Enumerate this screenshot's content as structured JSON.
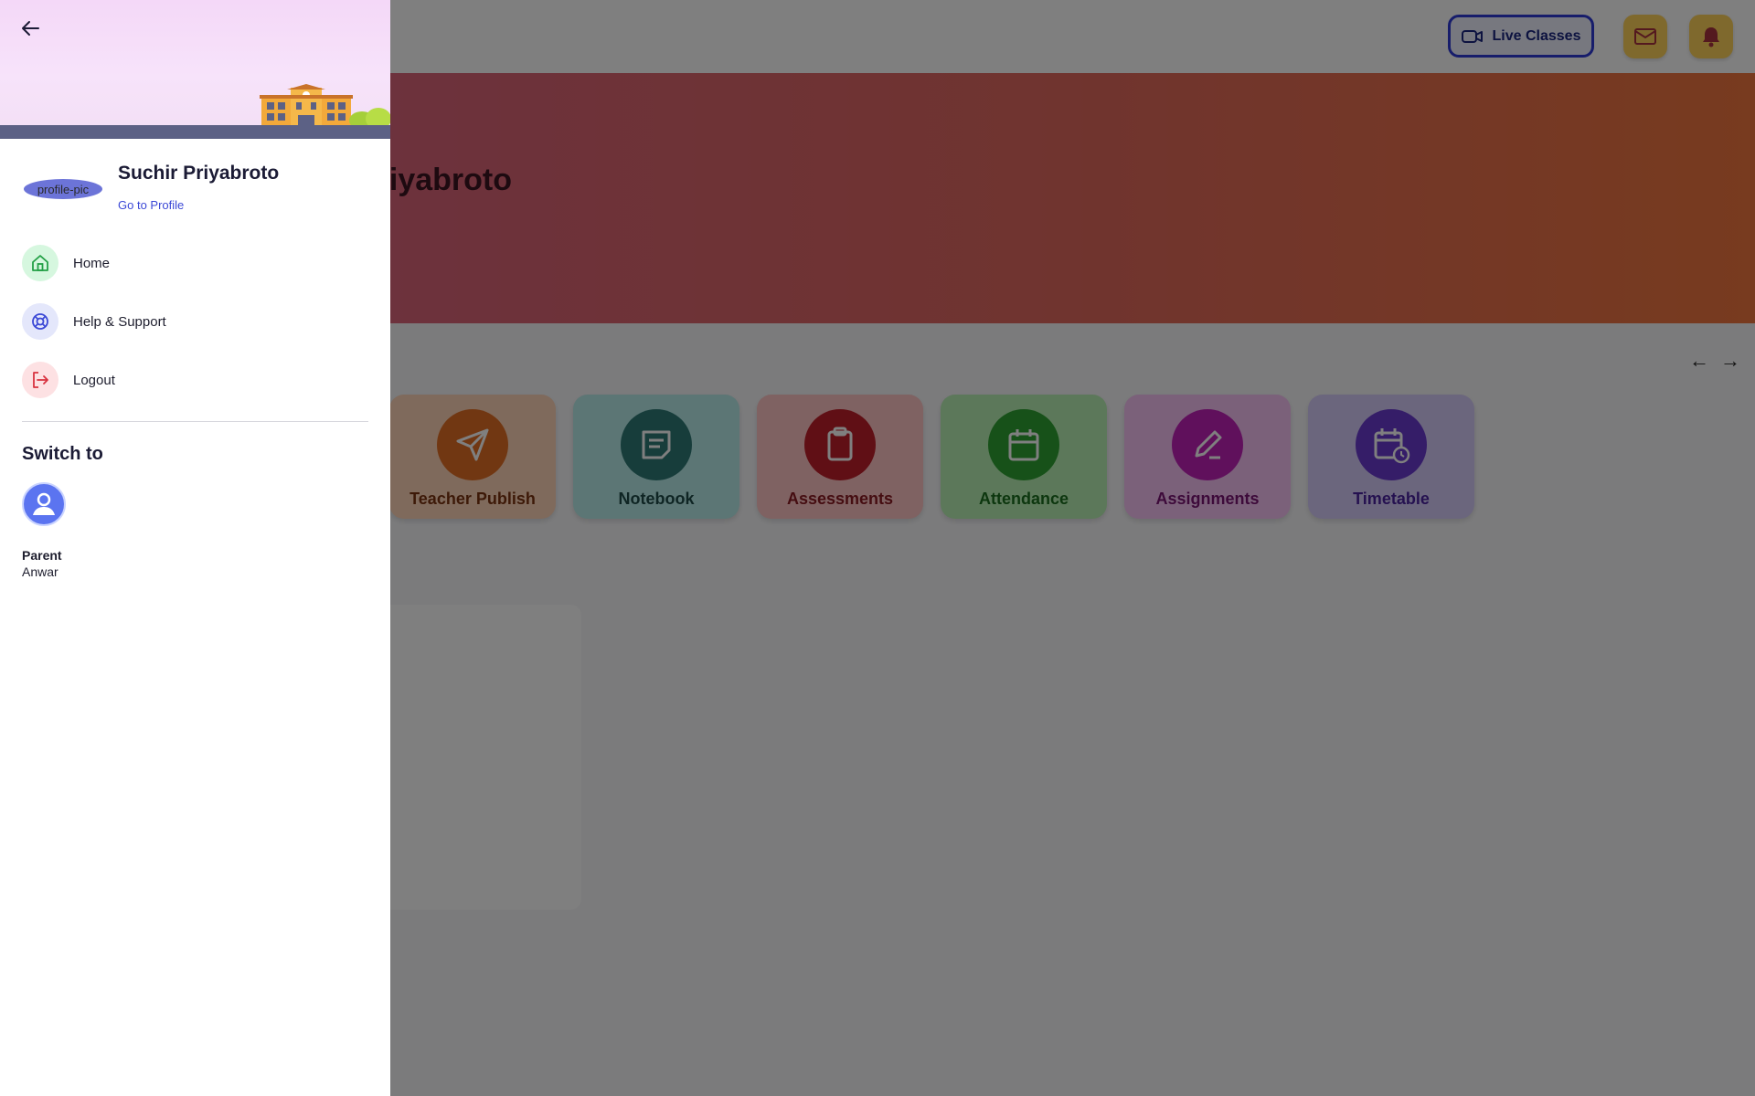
{
  "header": {
    "live_classes_label": "Live Classes",
    "mail_icon": "mail-icon",
    "bell_icon": "bell-icon"
  },
  "banner": {
    "name_fragment": "iyabroto"
  },
  "features": [
    {
      "label": "Teacher Publish",
      "icon": "send-icon",
      "color": "#ea8a4c"
    },
    {
      "label": "Notebook",
      "icon": "notebook-icon",
      "color": "#5fb8b4"
    },
    {
      "label": "Assessments",
      "icon": "clipboard-icon",
      "color": "#e8656a"
    },
    {
      "label": "Attendance",
      "icon": "calendar-icon",
      "color": "#59c95b"
    },
    {
      "label": "Assignments",
      "icon": "pencil-icon",
      "color": "#d86fd6"
    },
    {
      "label": "Timetable",
      "icon": "calendar-clock-icon",
      "color": "#8c7ad6"
    }
  ],
  "drawer": {
    "profile": {
      "name": "Suchir Priyabroto",
      "avatar_alt": "profile-pic",
      "link_label": "Go to Profile"
    },
    "nav": [
      {
        "label": "Home",
        "icon": "home-icon"
      },
      {
        "label": "Help & Support",
        "icon": "lifebuoy-icon"
      },
      {
        "label": "Logout",
        "icon": "logout-icon"
      }
    ],
    "switch_to": {
      "title": "Switch to",
      "role": "Parent",
      "name": "Anwar"
    }
  },
  "colors": {
    "accent": "#3b48d6",
    "banner_start": "#d6628a",
    "banner_end": "#f0763e"
  }
}
